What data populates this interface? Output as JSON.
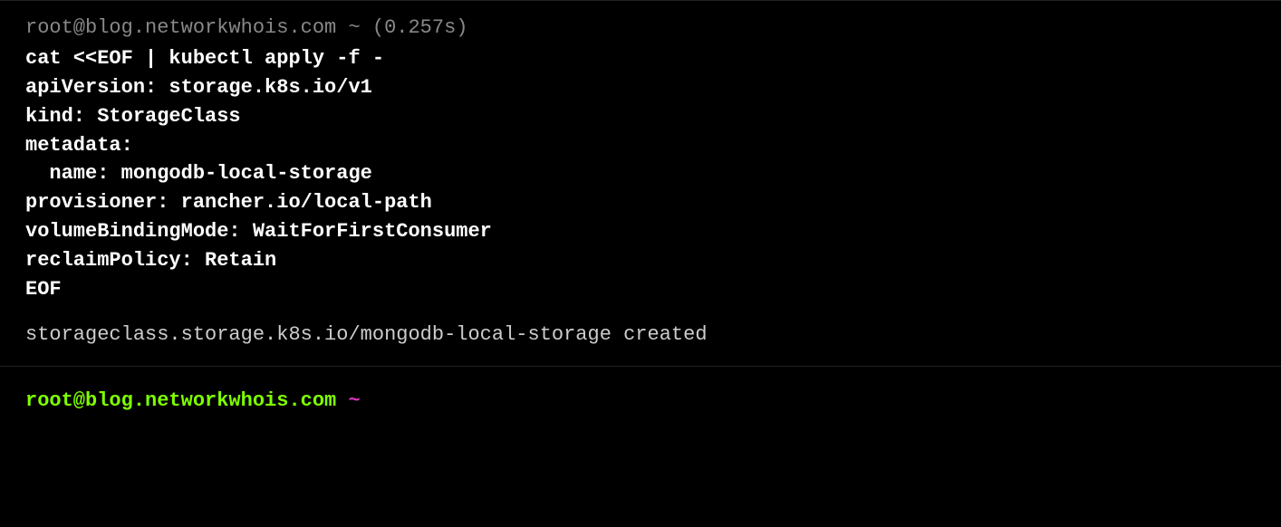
{
  "session1": {
    "header": "root@blog.networkwhois.com ~ (0.257s)",
    "command": "cat <<EOF | kubectl apply -f -\napiVersion: storage.k8s.io/v1\nkind: StorageClass\nmetadata:\n  name: mongodb-local-storage\nprovisioner: rancher.io/local-path\nvolumeBindingMode: WaitForFirstConsumer\nreclaimPolicy: Retain\nEOF",
    "output": "storageclass.storage.k8s.io/mongodb-local-storage created"
  },
  "session2": {
    "prompt_user": "root@blog.networkwhois.com ",
    "prompt_path": "~"
  }
}
